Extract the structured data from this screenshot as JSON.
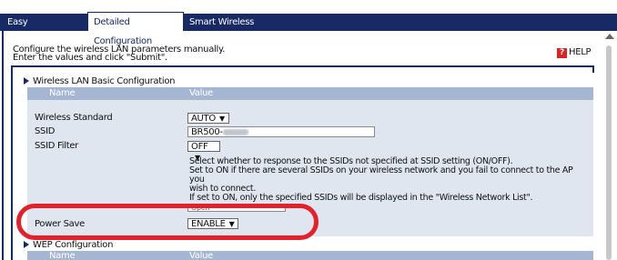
{
  "tabs": [
    {
      "label": "Easy Configuration",
      "active": false
    },
    {
      "label": "Detailed Configuration",
      "active": true
    },
    {
      "label": "Smart Wireless Setup",
      "active": false
    }
  ],
  "page": {
    "desc_line1": "Configure the wireless LAN parameters manually.",
    "desc_line2": "Enter the values and click \"Submit\".",
    "help_label": "HELP"
  },
  "basic_section": {
    "title": "Wireless LAN Basic Configuration",
    "col_name": "Name",
    "col_value": "Value",
    "rows": {
      "standard": {
        "label": "Wireless Standard",
        "value": "AUTO"
      },
      "ssid": {
        "label": "SSID",
        "value": "BR500-"
      },
      "ssid_filter": {
        "label": "SSID Filter",
        "value": "OFF"
      },
      "power_save": {
        "label": "Power Save",
        "value": "ENABLE"
      }
    },
    "filter_help": {
      "line1": "Select whether to response to the SSIDs not specified at SSID setting (ON/OFF).",
      "line2": " Set to ON if there are several SSIDs on your wireless network and you fail to connect to the AP you",
      "line3": "wish to connect.",
      "line4": " If set to ON, only the specified SSIDs will be displayed in the \"Wireless Network List\"."
    },
    "partial_field": "Open"
  },
  "wep_section": {
    "title": "WEP Configuration",
    "col_name": "Name",
    "col_value": "Value"
  },
  "colors": {
    "navy": "#182a66",
    "header": "#a4b6d2",
    "row_bg": "#dfe6f0",
    "highlight": "#e4202a"
  },
  "icons": {
    "help": "help-question-icon",
    "section": "triangle-right-icon",
    "dropdown": "chevron-down-icon"
  }
}
